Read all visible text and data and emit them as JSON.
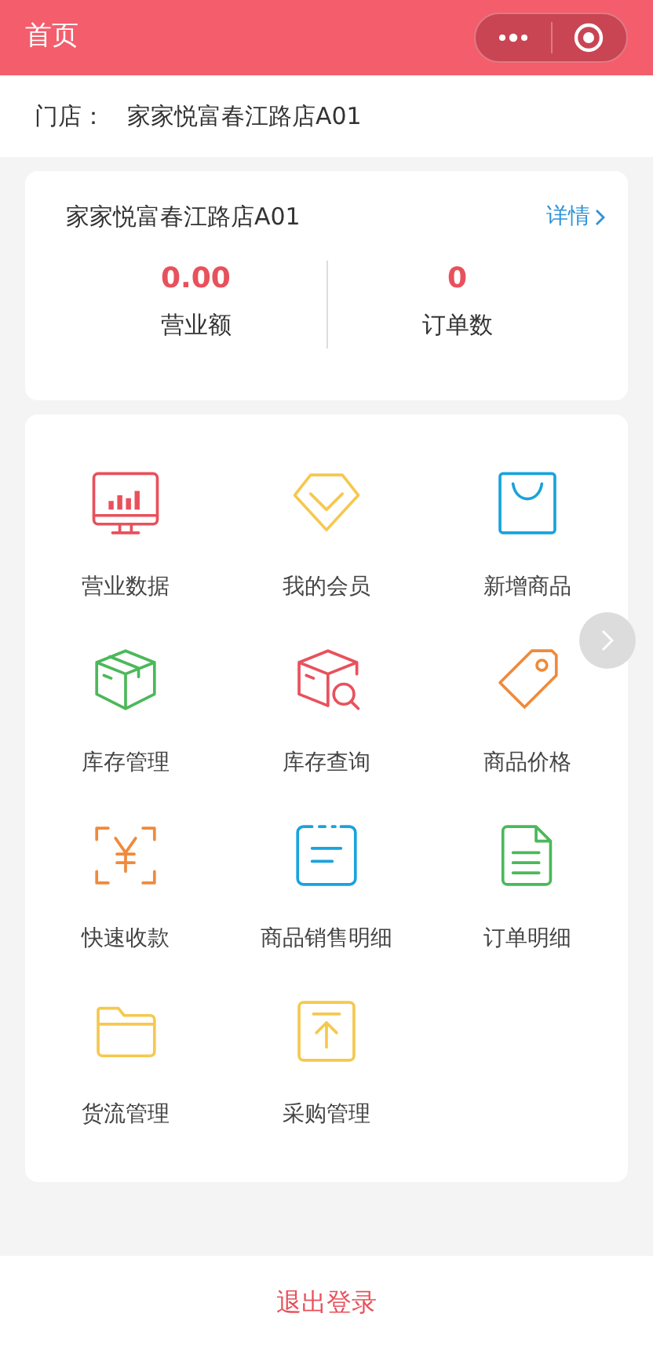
{
  "nav_bar": {
    "title": "首页"
  },
  "store_row": {
    "label": "门店：",
    "value": "家家悦富春江路店A01"
  },
  "summary_card": {
    "store_name": "家家悦富春江路店A01",
    "details_link": "详情",
    "stats": [
      {
        "value": "0.00",
        "label": "营业额"
      },
      {
        "value": "0",
        "label": "订单数"
      }
    ]
  },
  "menu": [
    {
      "label": "营业数据",
      "kind": "monitor",
      "color": "#e8515c"
    },
    {
      "label": "我的会员",
      "kind": "diamond",
      "color": "#f5c84f"
    },
    {
      "label": "新增商品",
      "kind": "bag",
      "color": "#1aa3dc"
    },
    {
      "label": "库存管理",
      "kind": "box",
      "color": "#4cb85a"
    },
    {
      "label": "库存查询",
      "kind": "boxsearch",
      "color": "#e8515c"
    },
    {
      "label": "商品价格",
      "kind": "tag",
      "color": "#f08a3a"
    },
    {
      "label": "快速收款",
      "kind": "scan",
      "color": "#f08a3a"
    },
    {
      "label": "商品销售明细",
      "kind": "note",
      "color": "#1aa3dc"
    },
    {
      "label": "订单明细",
      "kind": "doc",
      "color": "#4cb85a"
    },
    {
      "label": "货流管理",
      "kind": "folder",
      "color": "#f5c84f"
    },
    {
      "label": "采购管理",
      "kind": "upload",
      "color": "#f5c84f"
    }
  ],
  "logout_button": "退出登录"
}
